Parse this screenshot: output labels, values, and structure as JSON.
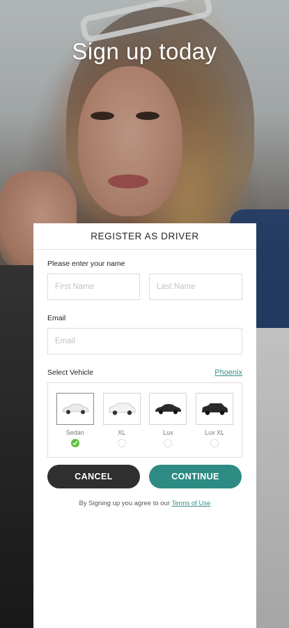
{
  "hero": {
    "title": "Sign up today"
  },
  "card": {
    "header": "REGISTER AS DRIVER",
    "name_section_label": "Please enter your name",
    "first_name": {
      "value": "",
      "placeholder": "First Name"
    },
    "last_name": {
      "value": "",
      "placeholder": "Last Name"
    },
    "email_section_label": "Email",
    "email": {
      "value": "",
      "placeholder": "Email"
    },
    "vehicle_section_label": "Select Vehicle",
    "city_link": "Phoenix",
    "vehicles": [
      {
        "label": "Sedan",
        "selected": true,
        "color": "#e9e9e9"
      },
      {
        "label": "XL",
        "selected": false,
        "color": "#f2f2f2"
      },
      {
        "label": "Lux",
        "selected": false,
        "color": "#2b2b2b"
      },
      {
        "label": "Lux XL",
        "selected": false,
        "color": "#2a2a2a"
      }
    ],
    "cancel_label": "CANCEL",
    "continue_label": "CONTINUE",
    "terms_prefix": "By Signing up you agree to our",
    "terms_link": "Terms of Use"
  },
  "colors": {
    "accent": "#2e8b84",
    "dark_button": "#2f2f2f",
    "check": "#5fbf3a"
  }
}
